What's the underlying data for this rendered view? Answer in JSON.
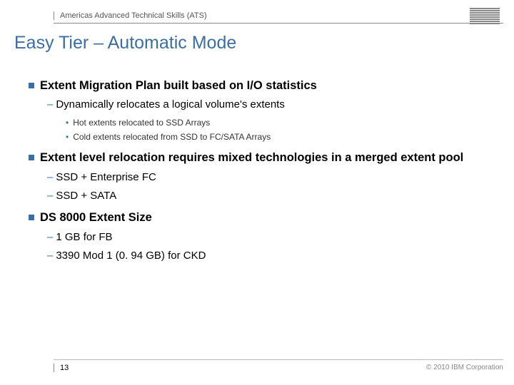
{
  "header": {
    "label": "Americas Advanced Technical Skills (ATS)",
    "logo_name": "ibm-logo"
  },
  "title": "Easy Tier – Automatic Mode",
  "bullets": [
    {
      "text": "Extent Migration Plan built based on I/O statistics",
      "sub": [
        {
          "text": "Dynamically relocates a logical volume's extents",
          "sub": [
            {
              "text": "Hot extents relocated to SSD Arrays"
            },
            {
              "text": "Cold extents relocated from SSD to FC/SATA Arrays"
            }
          ]
        }
      ]
    },
    {
      "text": "Extent level relocation requires mixed technologies in a merged extent pool",
      "sub": [
        {
          "text": "SSD + Enterprise FC"
        },
        {
          "text": "SSD + SATA"
        }
      ]
    },
    {
      "text": "DS 8000 Extent Size",
      "sub": [
        {
          "text": "1 GB for FB"
        },
        {
          "text": "3390 Mod 1 (0. 94 GB) for CKD"
        }
      ]
    }
  ],
  "footer": {
    "page": "13",
    "copyright": "© 2010 IBM Corporation"
  }
}
